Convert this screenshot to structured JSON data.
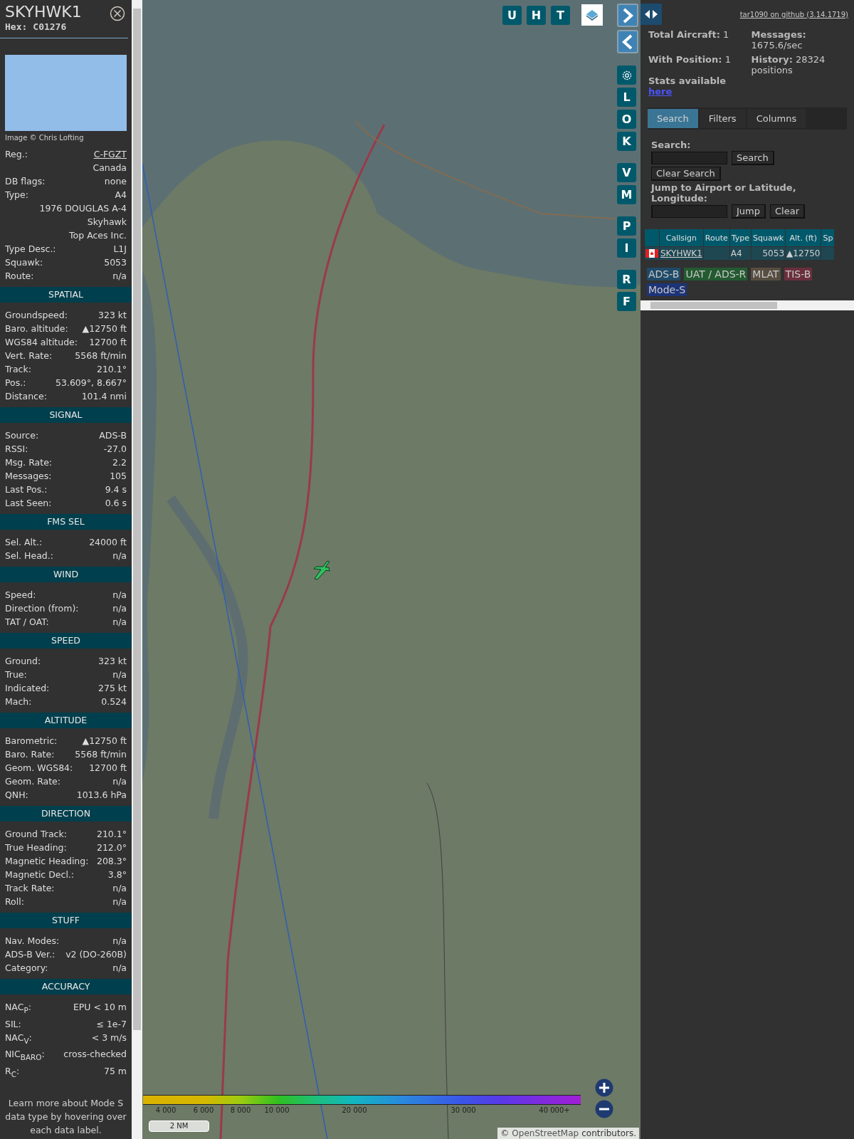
{
  "details": {
    "callsign": "SKYHWK1",
    "hex_label": "Hex:",
    "hex": "C01276",
    "photo_credit": "Image © Chris Lofting",
    "rows": [
      {
        "label": "Reg.:",
        "value": "C-FGZT",
        "kind": "link"
      },
      {
        "value": "Canada",
        "kind": "text"
      },
      {
        "label": "DB flags:",
        "value": "none",
        "kind": "text"
      },
      {
        "label": "Type:",
        "value": "A4",
        "kind": "text"
      },
      {
        "value": "1976 DOUGLAS A-4 Skyhawk",
        "kind": "text"
      },
      {
        "value": "Top Aces Inc.",
        "kind": "text"
      },
      {
        "label": "Type Desc.:",
        "value": "L1J",
        "kind": "text"
      },
      {
        "label": "Squawk:",
        "value": "5053",
        "kind": "text"
      },
      {
        "label": "Route:",
        "value": "n/a",
        "kind": "text"
      }
    ],
    "sections": [
      {
        "title": "SPATIAL",
        "rows": [
          {
            "label": "Groundspeed:",
            "value": "323 kt"
          },
          {
            "label": "Baro. altitude:",
            "value": "▲12750 ft"
          },
          {
            "label": "WGS84 altitude:",
            "value": "12700 ft"
          },
          {
            "label": "Vert. Rate:",
            "value": "5568 ft/min"
          },
          {
            "label": "Track:",
            "value": "210.1°"
          },
          {
            "label": "Pos.:",
            "value": "53.609°, 8.667°"
          },
          {
            "label": "Distance:",
            "value": "101.4 nmi"
          }
        ]
      },
      {
        "title": "SIGNAL",
        "rows": [
          {
            "label": "Source:",
            "value": "ADS-B"
          },
          {
            "label": "RSSI:",
            "value": "-27.0"
          },
          {
            "label": "Msg. Rate:",
            "value": "2.2"
          },
          {
            "label": "Messages:",
            "value": "105"
          },
          {
            "label": "Last Pos.:",
            "value": "9.4 s"
          },
          {
            "label": "Last Seen:",
            "value": "0.6 s"
          }
        ]
      },
      {
        "title": "FMS SEL",
        "rows": [
          {
            "label": "Sel. Alt.:",
            "value": "24000 ft"
          },
          {
            "label": "Sel. Head.:",
            "value": "n/a"
          }
        ]
      },
      {
        "title": "WIND",
        "rows": [
          {
            "label": "Speed:",
            "value": "n/a"
          },
          {
            "label": "Direction (from):",
            "value": "n/a"
          },
          {
            "label": "TAT / OAT:",
            "value": "n/a"
          }
        ]
      },
      {
        "title": "SPEED",
        "rows": [
          {
            "label": "Ground:",
            "value": "323 kt"
          },
          {
            "label": "True:",
            "value": "n/a"
          },
          {
            "label": "Indicated:",
            "value": "275 kt"
          },
          {
            "label": "Mach:",
            "value": "0.524"
          }
        ]
      },
      {
        "title": "ALTITUDE",
        "rows": [
          {
            "label": "Barometric:",
            "value": "▲12750 ft"
          },
          {
            "label": "Baro. Rate:",
            "value": "5568 ft/min"
          },
          {
            "label": "Geom. WGS84:",
            "value": "12700 ft"
          },
          {
            "label": "Geom. Rate:",
            "value": "n/a"
          },
          {
            "label": "QNH:",
            "value": "1013.6 hPa"
          }
        ]
      },
      {
        "title": "DIRECTION",
        "rows": [
          {
            "label": "Ground Track:",
            "value": "210.1°"
          },
          {
            "label": "True Heading:",
            "value": "212.0°"
          },
          {
            "label": "Magnetic Heading:",
            "value": "208.3°"
          },
          {
            "label": "Magnetic Decl.:",
            "value": "3.8°"
          },
          {
            "label": "Track Rate:",
            "value": "n/a"
          },
          {
            "label": "Roll:",
            "value": "n/a"
          }
        ]
      },
      {
        "title": "STUFF",
        "rows": [
          {
            "label": "Nav. Modes:",
            "value": "n/a"
          },
          {
            "label": "ADS-B Ver.:",
            "value": "v2 (DO-260B)"
          },
          {
            "label": "Category:",
            "value": "n/a"
          }
        ]
      },
      {
        "title": "ACCURACY",
        "rows": [
          {
            "label": "NAC$_{P}$:",
            "value": "EPU < 10 m"
          },
          {
            "label": "SIL:",
            "value": "≤ 1e-7"
          },
          {
            "label": "NAC$_{V}$:",
            "value": "< 3 m/s"
          },
          {
            "label": "NIC$_{BARO}$:",
            "value": "cross-checked"
          },
          {
            "label": "R$_{C}$:",
            "value": "75 m"
          }
        ]
      }
    ],
    "note": "Learn more about Mode S data type by hovering over each data label."
  },
  "map": {
    "top_buttons": [
      "U",
      "H",
      "T"
    ],
    "side_groups": [
      [
        {
          "kind": "forward"
        },
        {
          "kind": "back"
        }
      ],
      [
        {
          "kind": "settings"
        },
        {
          "kind": "letter",
          "label": "L"
        },
        {
          "kind": "letter",
          "label": "O"
        },
        {
          "kind": "letter",
          "label": "K"
        }
      ],
      [
        {
          "kind": "letter",
          "label": "V"
        },
        {
          "kind": "letter",
          "label": "M"
        }
      ],
      [
        {
          "kind": "letter",
          "label": "P"
        },
        {
          "kind": "letter",
          "label": "I"
        }
      ],
      [
        {
          "kind": "letter",
          "label": "R"
        },
        {
          "kind": "letter",
          "label": "F"
        }
      ]
    ],
    "legend_ticks": [
      "4 000",
      "6 000",
      "8 000",
      "10 000",
      "20 000",
      "30 000",
      "40 000+"
    ],
    "scale": "2 NM",
    "attribution_prefix": "©",
    "attribution_link": "OpenStreetMap",
    "attribution_suffix": "contributors."
  },
  "side": {
    "github_link": "tar1090 on github (3.14.1719)",
    "stats_left": [
      "**Total Aircraft:** 1",
      "**With Position:** 1"
    ],
    "stats_label": "Stats available",
    "stats_link": "here",
    "stats_right": [
      "**Messages:** 1675.6/sec",
      "**History:** 28324 positions"
    ],
    "tabs": [
      {
        "label": "Search",
        "selected": true
      },
      {
        "label": "Filters",
        "selected": false
      },
      {
        "label": "Columns",
        "selected": false
      }
    ],
    "search_label": "Search:",
    "search_button": "Search",
    "clear_search_button": "Clear Search",
    "jump_label": "Jump to Airport or Latitude, Longitude:",
    "jump_button": "Jump",
    "clear_button": "Clear",
    "table": {
      "columns": [
        "Callsign",
        "Route",
        "Type",
        "Squawk",
        "Alt. (ft)",
        "Sp"
      ],
      "rows": [
        {
          "selected": true,
          "callsign": "SKYHWK1",
          "type": "A4",
          "squawk": "5053",
          "altitude": "▲12750"
        }
      ]
    },
    "sources": [
      {
        "label": "ADS-B",
        "color": "#1f4a68"
      },
      {
        "label": "UAT / ADS-R",
        "color": "#245a30"
      },
      {
        "label": "MLAT",
        "color": "#564d40"
      },
      {
        "label": "TIS-B",
        "color": "#6a2f3c"
      },
      {
        "label": "Mode-S",
        "color": "#1d3478"
      }
    ]
  }
}
